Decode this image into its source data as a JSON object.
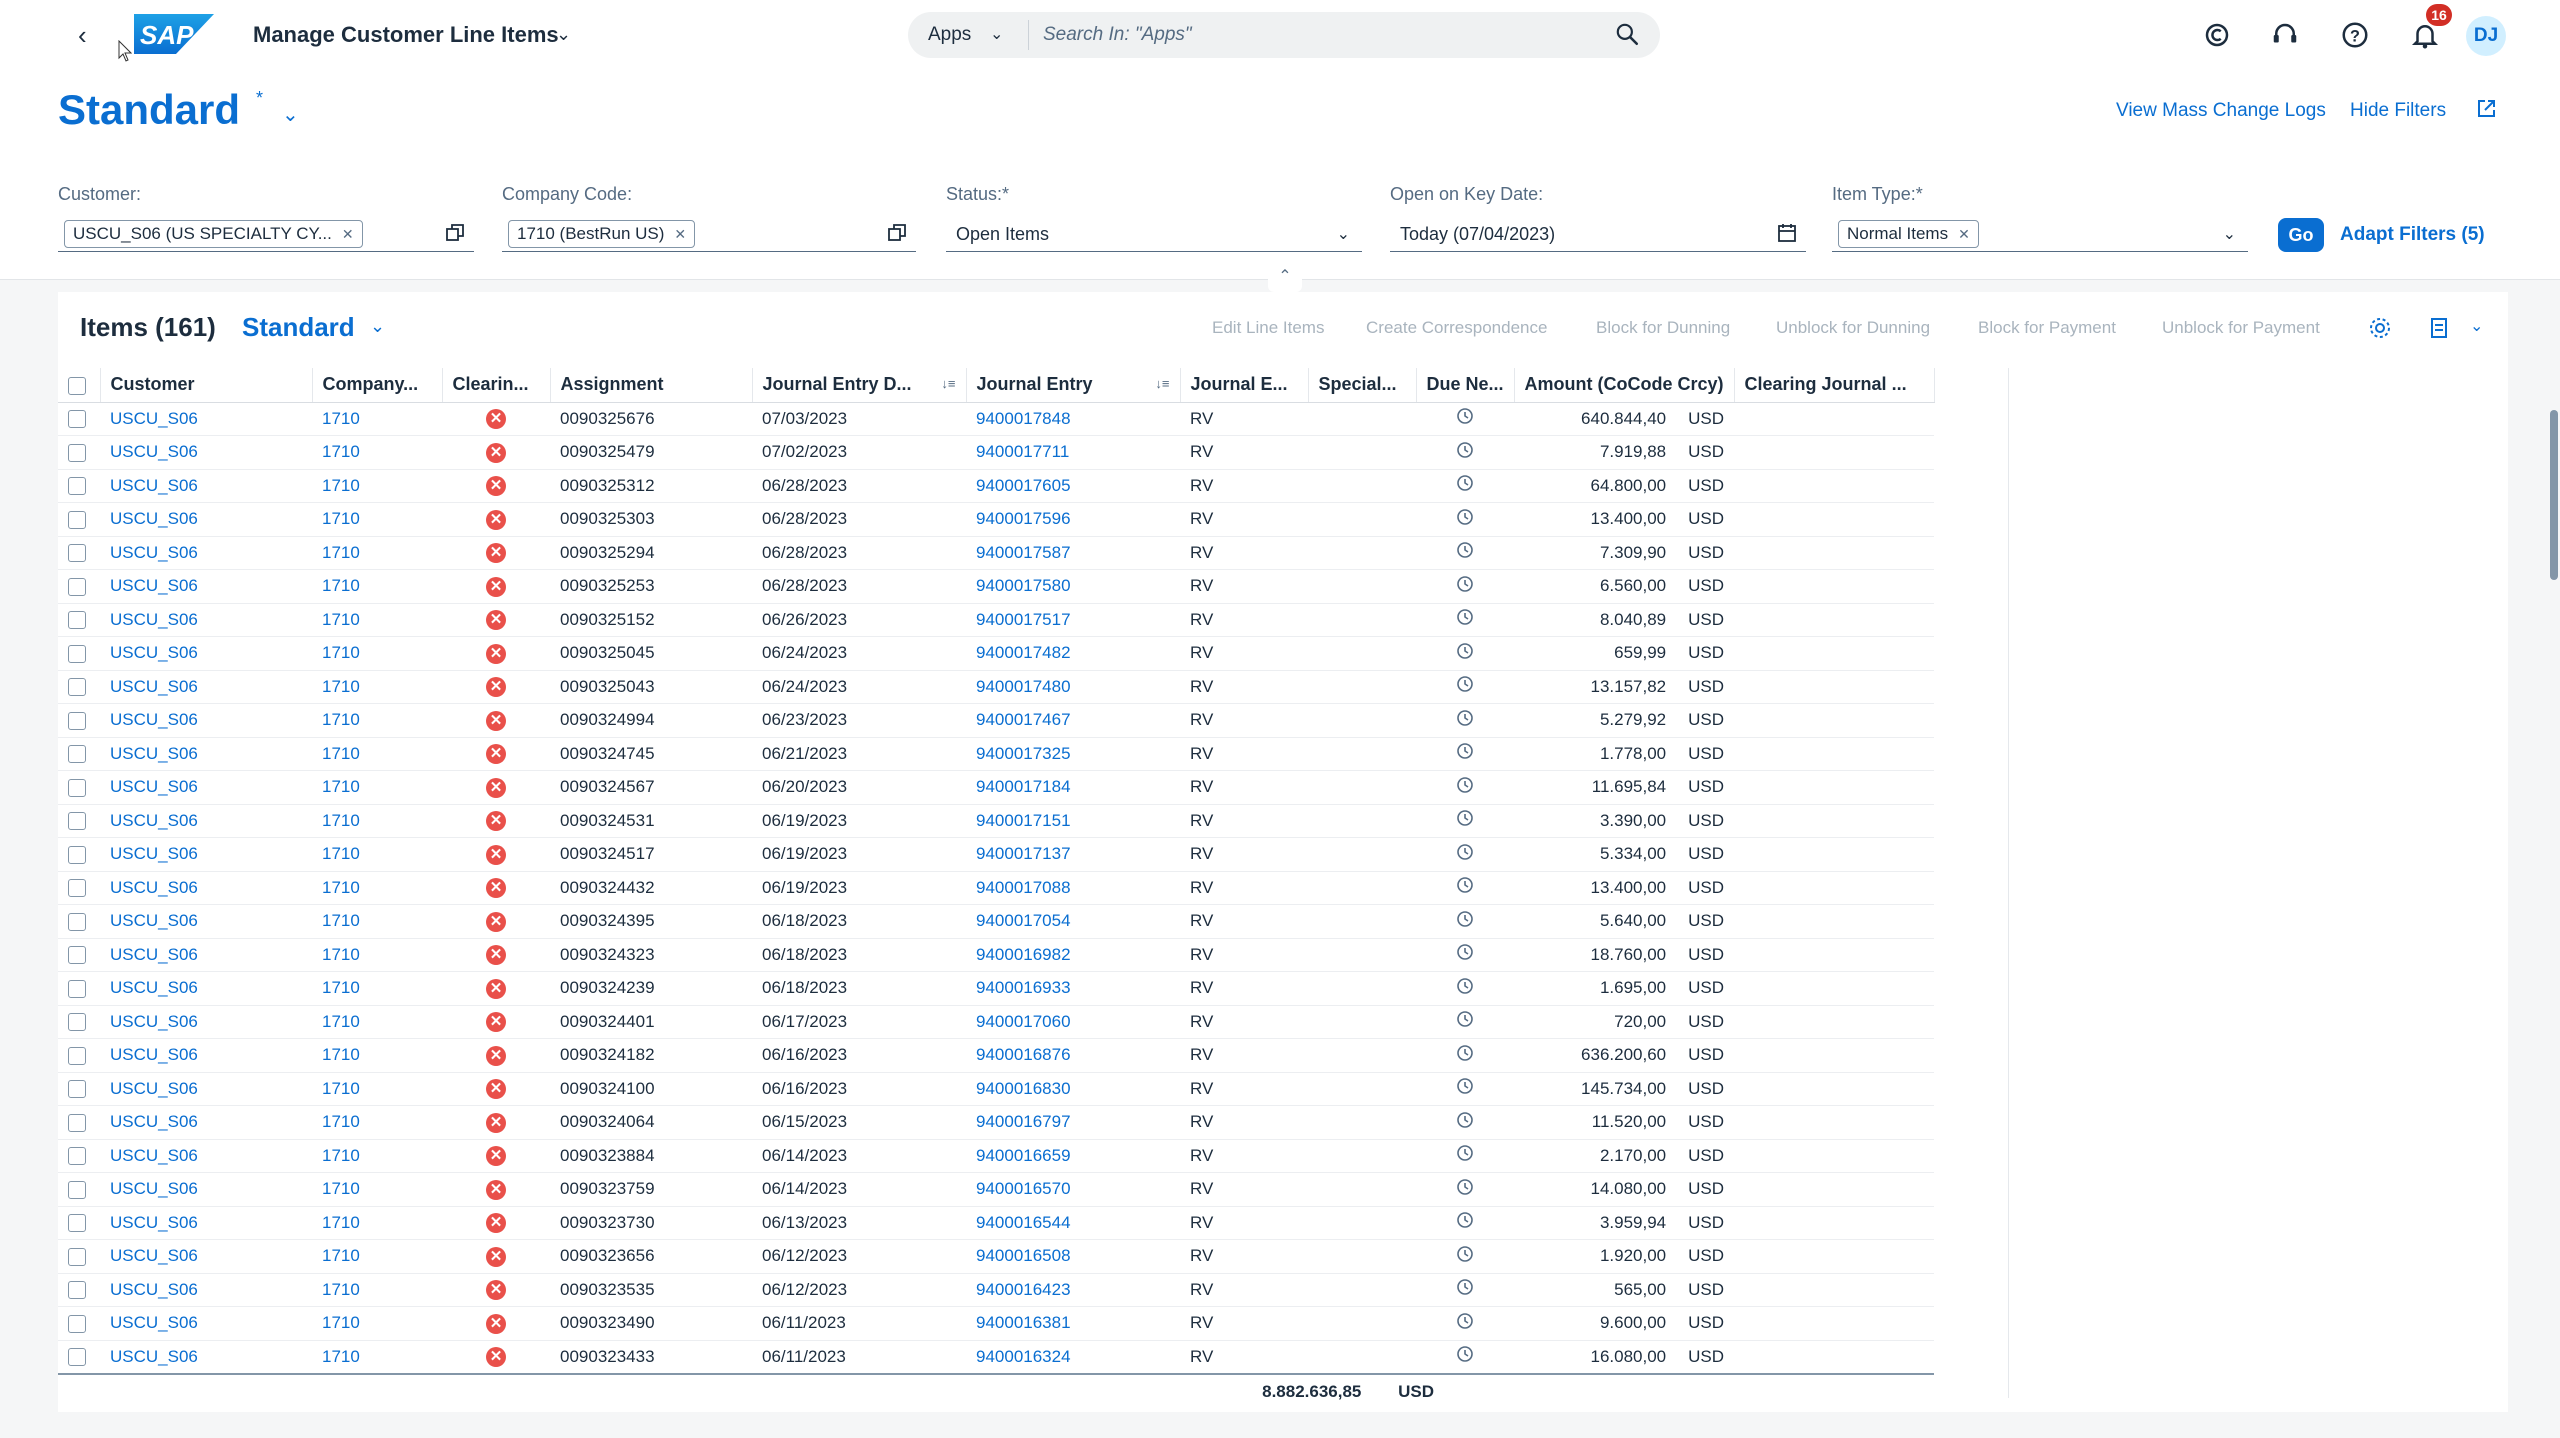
{
  "shell": {
    "app_title": "Manage Customer Line Items",
    "search_scope": "Apps",
    "search_placeholder": "Search In: \"Apps\"",
    "notification_count": "16",
    "avatar_initials": "DJ"
  },
  "header": {
    "variant_name": "Standard",
    "variant_modified_marker": "*",
    "links": {
      "mass_change_logs": "View Mass Change Logs",
      "hide_filters": "Hide Filters"
    }
  },
  "filters": {
    "customer": {
      "label": "Customer:",
      "token": "USCU_S06 (US SPECIALTY CY..."
    },
    "company_code": {
      "label": "Company Code:",
      "token": "1710 (BestRun US)"
    },
    "status": {
      "label": "Status:*",
      "value": "Open Items"
    },
    "key_date": {
      "label": "Open on Key Date:",
      "value": "Today (07/04/2023)"
    },
    "item_type": {
      "label": "Item Type:*",
      "token": "Normal Items"
    },
    "go_label": "Go",
    "adapt_label": "Adapt Filters (5)"
  },
  "table": {
    "title": "Items (161)",
    "variant": "Standard",
    "actions": [
      "Edit Line Items",
      "Create Correspondence",
      "Block for Dunning",
      "Unblock for Dunning",
      "Block for Payment",
      "Unblock for Payment"
    ],
    "columns": [
      "Customer",
      "Company...",
      "Clearin...",
      "Assignment",
      "Journal Entry D...",
      "Journal Entry",
      "Journal E...",
      "Special...",
      "Due Ne...",
      "Amount (CoCode Crcy)",
      "Clearing Journal ..."
    ],
    "rows": [
      [
        "USCU_S06",
        "1710",
        "0090325676",
        "07/03/2023",
        "9400017848",
        "RV",
        "640.844,40",
        "USD"
      ],
      [
        "USCU_S06",
        "1710",
        "0090325479",
        "07/02/2023",
        "9400017711",
        "RV",
        "7.919,88",
        "USD"
      ],
      [
        "USCU_S06",
        "1710",
        "0090325312",
        "06/28/2023",
        "9400017605",
        "RV",
        "64.800,00",
        "USD"
      ],
      [
        "USCU_S06",
        "1710",
        "0090325303",
        "06/28/2023",
        "9400017596",
        "RV",
        "13.400,00",
        "USD"
      ],
      [
        "USCU_S06",
        "1710",
        "0090325294",
        "06/28/2023",
        "9400017587",
        "RV",
        "7.309,90",
        "USD"
      ],
      [
        "USCU_S06",
        "1710",
        "0090325253",
        "06/28/2023",
        "9400017580",
        "RV",
        "6.560,00",
        "USD"
      ],
      [
        "USCU_S06",
        "1710",
        "0090325152",
        "06/26/2023",
        "9400017517",
        "RV",
        "8.040,89",
        "USD"
      ],
      [
        "USCU_S06",
        "1710",
        "0090325045",
        "06/24/2023",
        "9400017482",
        "RV",
        "659,99",
        "USD"
      ],
      [
        "USCU_S06",
        "1710",
        "0090325043",
        "06/24/2023",
        "9400017480",
        "RV",
        "13.157,82",
        "USD"
      ],
      [
        "USCU_S06",
        "1710",
        "0090324994",
        "06/23/2023",
        "9400017467",
        "RV",
        "5.279,92",
        "USD"
      ],
      [
        "USCU_S06",
        "1710",
        "0090324745",
        "06/21/2023",
        "9400017325",
        "RV",
        "1.778,00",
        "USD"
      ],
      [
        "USCU_S06",
        "1710",
        "0090324567",
        "06/20/2023",
        "9400017184",
        "RV",
        "11.695,84",
        "USD"
      ],
      [
        "USCU_S06",
        "1710",
        "0090324531",
        "06/19/2023",
        "9400017151",
        "RV",
        "3.390,00",
        "USD"
      ],
      [
        "USCU_S06",
        "1710",
        "0090324517",
        "06/19/2023",
        "9400017137",
        "RV",
        "5.334,00",
        "USD"
      ],
      [
        "USCU_S06",
        "1710",
        "0090324432",
        "06/19/2023",
        "9400017088",
        "RV",
        "13.400,00",
        "USD"
      ],
      [
        "USCU_S06",
        "1710",
        "0090324395",
        "06/18/2023",
        "9400017054",
        "RV",
        "5.640,00",
        "USD"
      ],
      [
        "USCU_S06",
        "1710",
        "0090324323",
        "06/18/2023",
        "9400016982",
        "RV",
        "18.760,00",
        "USD"
      ],
      [
        "USCU_S06",
        "1710",
        "0090324239",
        "06/18/2023",
        "9400016933",
        "RV",
        "1.695,00",
        "USD"
      ],
      [
        "USCU_S06",
        "1710",
        "0090324401",
        "06/17/2023",
        "9400017060",
        "RV",
        "720,00",
        "USD"
      ],
      [
        "USCU_S06",
        "1710",
        "0090324182",
        "06/16/2023",
        "9400016876",
        "RV",
        "636.200,60",
        "USD"
      ],
      [
        "USCU_S06",
        "1710",
        "0090324100",
        "06/16/2023",
        "9400016830",
        "RV",
        "145.734,00",
        "USD"
      ],
      [
        "USCU_S06",
        "1710",
        "0090324064",
        "06/15/2023",
        "9400016797",
        "RV",
        "11.520,00",
        "USD"
      ],
      [
        "USCU_S06",
        "1710",
        "0090323884",
        "06/14/2023",
        "9400016659",
        "RV",
        "2.170,00",
        "USD"
      ],
      [
        "USCU_S06",
        "1710",
        "0090323759",
        "06/14/2023",
        "9400016570",
        "RV",
        "14.080,00",
        "USD"
      ],
      [
        "USCU_S06",
        "1710",
        "0090323730",
        "06/13/2023",
        "9400016544",
        "RV",
        "3.959,94",
        "USD"
      ],
      [
        "USCU_S06",
        "1710",
        "0090323656",
        "06/12/2023",
        "9400016508",
        "RV",
        "1.920,00",
        "USD"
      ],
      [
        "USCU_S06",
        "1710",
        "0090323535",
        "06/12/2023",
        "9400016423",
        "RV",
        "565,00",
        "USD"
      ],
      [
        "USCU_S06",
        "1710",
        "0090323490",
        "06/11/2023",
        "9400016381",
        "RV",
        "9.600,00",
        "USD"
      ],
      [
        "USCU_S06",
        "1710",
        "0090323433",
        "06/11/2023",
        "9400016324",
        "RV",
        "16.080,00",
        "USD"
      ]
    ],
    "total_amount": "8.882.636,85",
    "total_currency": "USD"
  },
  "colors": {
    "accent": "#0a6ed1",
    "error": "#e9504a",
    "text": "#1d2d3e"
  },
  "icons": {
    "clearing_status": "error-circle-icon",
    "due_net": "clock-refresh-icon"
  }
}
